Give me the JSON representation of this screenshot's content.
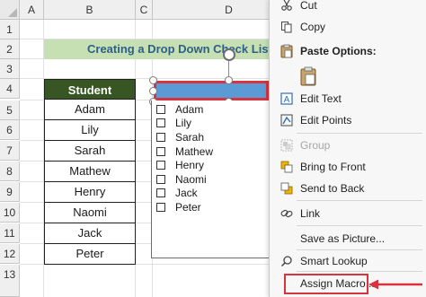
{
  "columns": [
    "A",
    "B",
    "C",
    "D"
  ],
  "rows": [
    "1",
    "2",
    "3",
    "4",
    "5",
    "6",
    "7",
    "8",
    "9",
    "10",
    "11",
    "12",
    "13"
  ],
  "title_banner": "Creating a Drop Down Check List",
  "student_table": {
    "header": "Student",
    "rows": [
      "Adam",
      "Lily",
      "Sarah",
      "Mathew",
      "Henry",
      "Naomi",
      "Jack",
      "Peter"
    ]
  },
  "check_list": {
    "items": [
      "Adam",
      "Lily",
      "Sarah",
      "Mathew",
      "Henry",
      "Naomi",
      "Jack",
      "Peter"
    ]
  },
  "context_menu": {
    "cut": "Cut",
    "copy": "Copy",
    "paste_options": "Paste Options:",
    "edit_text": "Edit Text",
    "edit_points": "Edit Points",
    "group": "Group",
    "bring_to_front": "Bring to Front",
    "send_to_back": "Send to Back",
    "link": "Link",
    "save_as_picture": "Save as Picture...",
    "smart_lookup": "Smart Lookup",
    "assign_macro": "Assign Macro..."
  },
  "colors": {
    "banner_bg": "#c6e0b4",
    "banner_text": "#2d5f8a",
    "table_header_bg": "#375623",
    "dropdown_fill": "#5b9bd5",
    "highlight_red": "#d9333f"
  }
}
